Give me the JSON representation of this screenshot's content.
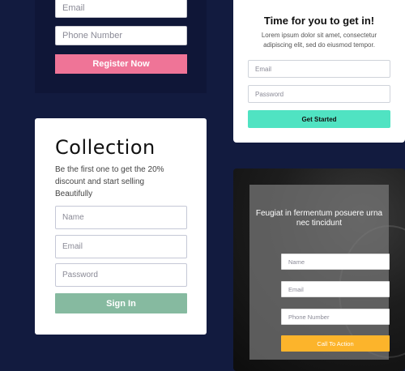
{
  "card1": {
    "email_placeholder": "Email",
    "phone_placeholder": "Phone Number",
    "button_label": "Register Now"
  },
  "card2": {
    "title": "Time for you to get in!",
    "description": "Lorem ipsum dolor sit amet, consectetur adipiscing elit, sed do eiusmod tempor.",
    "email_placeholder": "Email",
    "password_placeholder": "Password",
    "button_label": "Get Started"
  },
  "card3": {
    "title": "Collection",
    "description": "Be the first one to get the 20% discount and start selling Beautifully",
    "name_placeholder": "Name",
    "email_placeholder": "Email",
    "password_placeholder": "Password",
    "button_label": "Sign In"
  },
  "card4": {
    "title": "Feugiat in fermentum posuere urna nec tincidunt",
    "name_placeholder": "Name",
    "email_placeholder": "Email",
    "phone_placeholder": "Phone Number",
    "button_label": "Call To Action"
  },
  "colors": {
    "background": "#121b3f",
    "register_button": "#ef7497",
    "get_started_button": "#50e3c2",
    "sign_in_button": "#86baa0",
    "call_to_action_button": "#fcb42b"
  }
}
